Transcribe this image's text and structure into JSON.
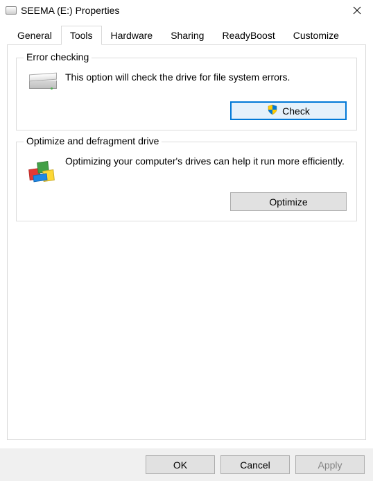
{
  "window": {
    "title": "SEEMA (E:) Properties"
  },
  "tabs": {
    "general": "General",
    "tools": "Tools",
    "hardware": "Hardware",
    "sharing": "Sharing",
    "readyboost": "ReadyBoost",
    "customize": "Customize",
    "active": "tools"
  },
  "error_check": {
    "title": "Error checking",
    "desc": "This option will check the drive for file system errors.",
    "button": "Check"
  },
  "optimize": {
    "title": "Optimize and defragment drive",
    "desc": "Optimizing your computer's drives can help it run more efficiently.",
    "button": "Optimize"
  },
  "footer": {
    "ok": "OK",
    "cancel": "Cancel",
    "apply": "Apply"
  }
}
